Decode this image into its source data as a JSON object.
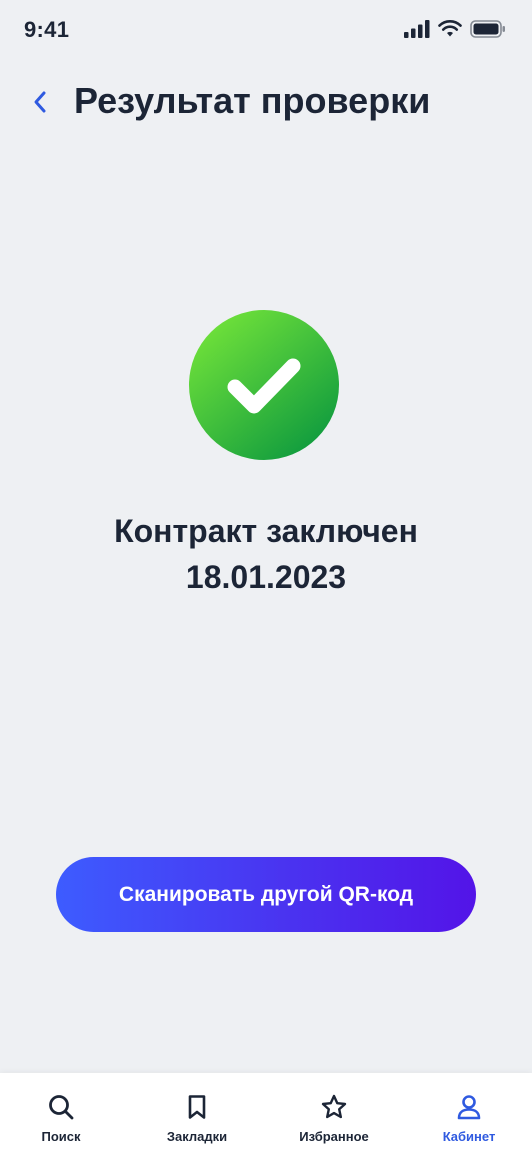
{
  "status_bar": {
    "time": "9:41"
  },
  "header": {
    "title": "Результат проверки"
  },
  "result": {
    "status": "success",
    "line1": "Контракт заключен",
    "line2": "18.01.2023"
  },
  "actions": {
    "scan_label": "Сканировать другой QR-код"
  },
  "tabs": [
    {
      "label": "Поиск",
      "icon": "search-icon",
      "active": false
    },
    {
      "label": "Закладки",
      "icon": "bookmark-icon",
      "active": false
    },
    {
      "label": "Избранное",
      "icon": "star-icon",
      "active": false
    },
    {
      "label": "Кабинет",
      "icon": "user-icon",
      "active": true
    }
  ],
  "colors": {
    "background": "#eef0f3",
    "text": "#1c2536",
    "accent": "#2f5ae0",
    "success_start": "#6ee03a",
    "success_end": "#0e9a3e",
    "button_start": "#3d5cff",
    "button_end": "#5314e8"
  }
}
